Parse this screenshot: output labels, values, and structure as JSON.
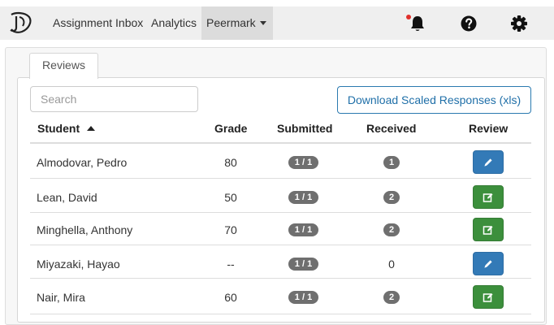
{
  "nav": {
    "links": [
      "Assignment Inbox",
      "Analytics",
      "Peermark"
    ],
    "icons": [
      "logo-icon",
      "bell-icon",
      "help-icon",
      "gear-icon"
    ],
    "notification_color": "#e0302b"
  },
  "tab": {
    "label": "Reviews"
  },
  "search": {
    "placeholder": "Search"
  },
  "download": {
    "label": "Download Scaled Responses (xls)"
  },
  "table": {
    "headers": {
      "student": "Student",
      "grade": "Grade",
      "submitted": "Submitted",
      "received": "Received",
      "review": "Review"
    },
    "sort": "student-ascending",
    "rows": [
      {
        "name": "Almodovar, Pedro",
        "grade": "80",
        "submitted": "1 / 1",
        "received": "1",
        "received_badge": true,
        "review_action": "pencil-icon",
        "review_color": "#337ab7"
      },
      {
        "name": "Lean, David",
        "grade": "50",
        "submitted": "1 / 1",
        "received": "2",
        "received_badge": true,
        "review_action": "edit-icon",
        "review_color": "#3c8f3c"
      },
      {
        "name": "Minghella, Anthony",
        "grade": "70",
        "submitted": "1 / 1",
        "received": "2",
        "received_badge": true,
        "review_action": "edit-icon",
        "review_color": "#3c8f3c"
      },
      {
        "name": "Miyazaki, Hayao",
        "grade": "--",
        "submitted": "1 / 1",
        "received": "0",
        "received_badge": false,
        "review_action": "pencil-icon",
        "review_color": "#337ab7"
      },
      {
        "name": "Nair, Mira",
        "grade": "60",
        "submitted": "1 / 1",
        "received": "2",
        "received_badge": true,
        "review_action": "edit-icon",
        "review_color": "#3c8f3c"
      }
    ]
  }
}
